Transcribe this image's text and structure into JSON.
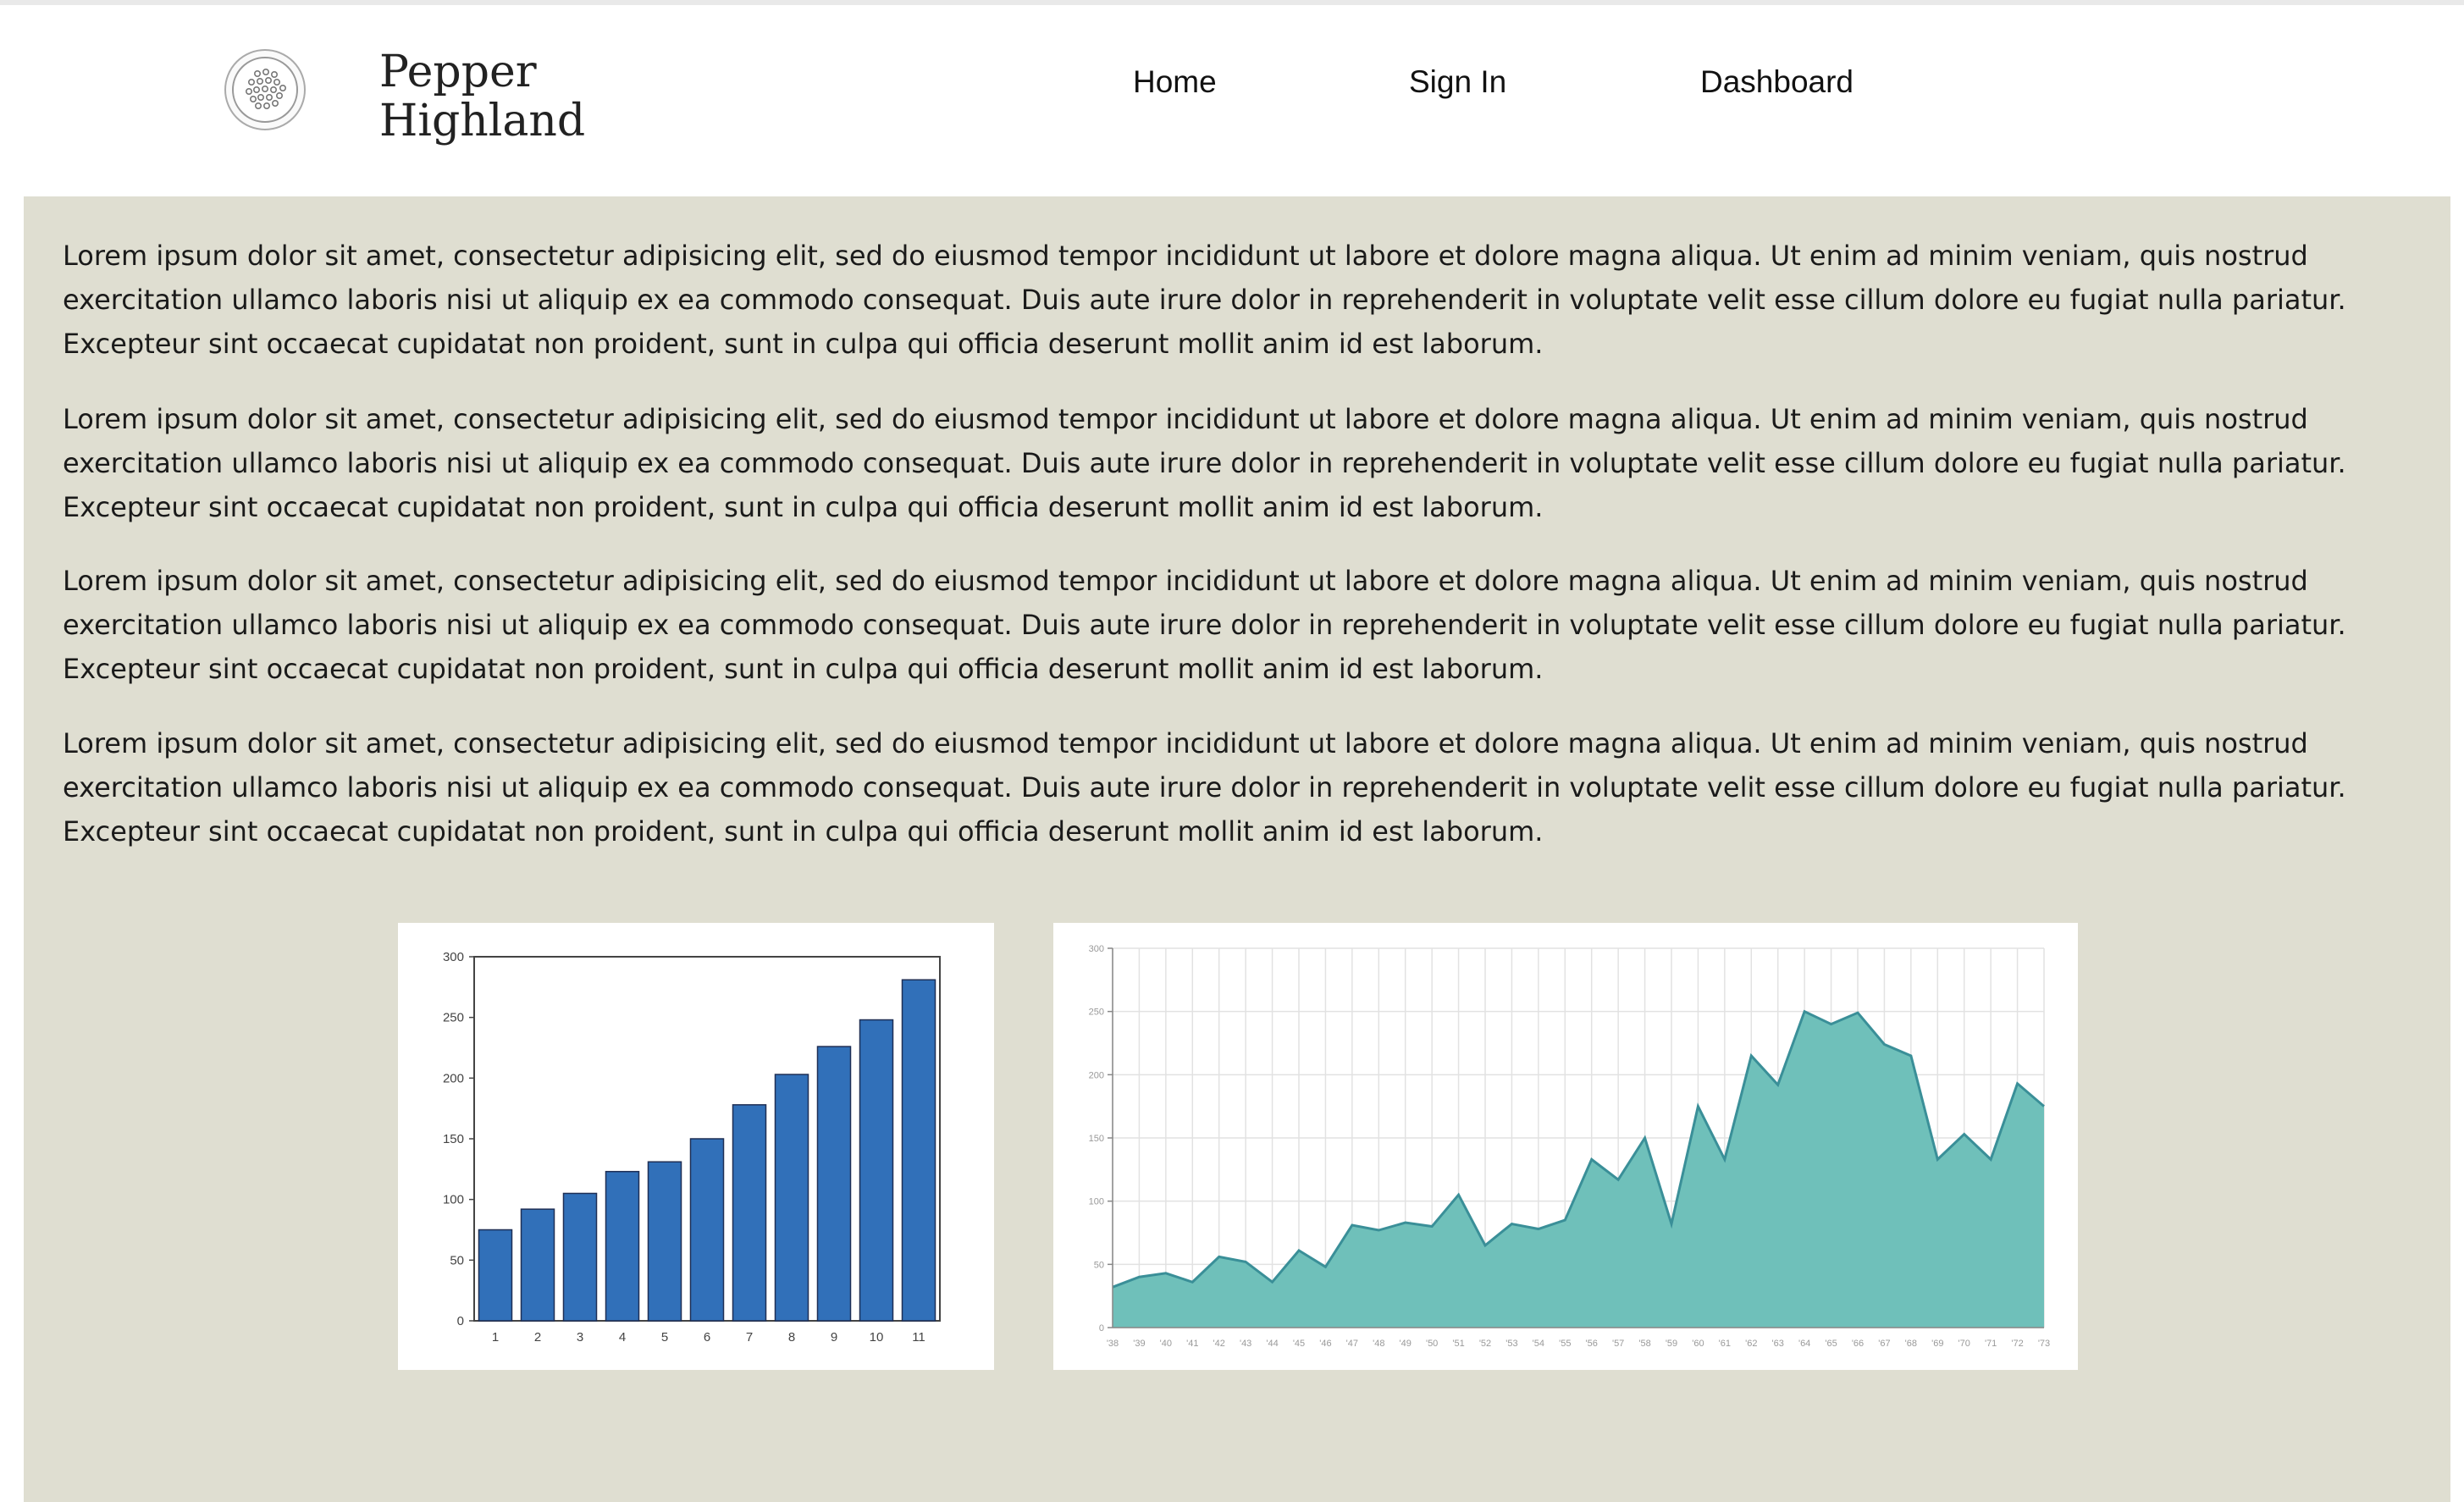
{
  "brand": {
    "line1": "Pepper",
    "line2": "Highland",
    "logo_icon": "peppercorn-dish-icon"
  },
  "nav": [
    {
      "label": "Home"
    },
    {
      "label": "Sign In"
    },
    {
      "label": "Dashboard"
    }
  ],
  "paragraphs": [
    "Lorem ipsum dolor sit amet, consectetur adipisicing elit, sed do eiusmod tempor incididunt ut labore et dolore magna aliqua. Ut enim ad minim veniam, quis nostrud exercitation ullamco laboris nisi ut aliquip ex ea commodo consequat. Duis aute irure dolor in reprehenderit in voluptate velit esse cillum dolore eu fugiat nulla pariatur. Excepteur sint occaecat cupidatat non proident, sunt in culpa qui officia deserunt mollit anim id est laborum.",
    "Lorem ipsum dolor sit amet, consectetur adipisicing elit, sed do eiusmod tempor incididunt ut labore et dolore magna aliqua. Ut enim ad minim veniam, quis nostrud exercitation ullamco laboris nisi ut aliquip ex ea commodo consequat. Duis aute irure dolor in reprehenderit in voluptate velit esse cillum dolore eu fugiat nulla pariatur. Excepteur sint occaecat cupidatat non proident, sunt in culpa qui officia deserunt mollit anim id est laborum.",
    "Lorem ipsum dolor sit amet, consectetur adipisicing elit, sed do eiusmod tempor incididunt ut labore et dolore magna aliqua. Ut enim ad minim veniam, quis nostrud exercitation ullamco laboris nisi ut aliquip ex ea commodo consequat. Duis aute irure dolor in reprehenderit in voluptate velit esse cillum dolore eu fugiat nulla pariatur. Excepteur sint occaecat cupidatat non proident, sunt in culpa qui officia deserunt mollit anim id est laborum.",
    "Lorem ipsum dolor sit amet, consectetur adipisicing elit, sed do eiusmod tempor incididunt ut labore et dolore magna aliqua. Ut enim ad minim veniam, quis nostrud exercitation ullamco laboris nisi ut aliquip ex ea commodo consequat. Duis aute irure dolor in reprehenderit in voluptate velit esse cillum dolore eu fugiat nulla pariatur. Excepteur sint occaecat cupidatat non proident, sunt in culpa qui officia deserunt mollit anim id est laborum."
  ],
  "colors": {
    "content_bg": "#dfded1",
    "bar": "#3170b9",
    "area_fill": "#6fc0ba",
    "area_line": "#3a8f98"
  },
  "chart_data": [
    {
      "type": "bar",
      "categories": [
        "1",
        "2",
        "3",
        "4",
        "5",
        "6",
        "7",
        "8",
        "9",
        "10",
        "11"
      ],
      "values": [
        75,
        92,
        105,
        123,
        131,
        150,
        178,
        203,
        226,
        248,
        281
      ],
      "ylim": [
        0,
        300
      ],
      "yticks": [
        0,
        50,
        100,
        150,
        200,
        250,
        300
      ],
      "grid": false
    },
    {
      "type": "area",
      "x": [
        "'38",
        "'39",
        "'40",
        "'41",
        "'42",
        "'43",
        "'44",
        "'45",
        "'46",
        "'47",
        "'48",
        "'49",
        "'50",
        "'51",
        "'52",
        "'53",
        "'54",
        "'55",
        "'56",
        "'57",
        "'58",
        "'59",
        "'60",
        "'61",
        "'62",
        "'63",
        "'64",
        "'65",
        "'66",
        "'67",
        "'68",
        "'69",
        "'70",
        "'71",
        "'72",
        "'73"
      ],
      "values": [
        32,
        40,
        43,
        36,
        56,
        52,
        36,
        61,
        48,
        81,
        77,
        83,
        80,
        105,
        65,
        82,
        78,
        85,
        133,
        117,
        150,
        82,
        175,
        133,
        215,
        192,
        250,
        240,
        249,
        224,
        215,
        133,
        153,
        133,
        193,
        175
      ],
      "ylim": [
        0,
        300
      ],
      "yticks": [
        0,
        50,
        100,
        150,
        200,
        250,
        300
      ],
      "grid": true
    }
  ]
}
